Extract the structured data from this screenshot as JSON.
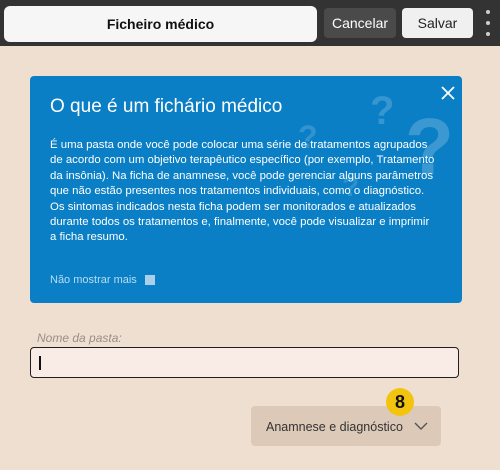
{
  "header": {
    "title": "Ficheiro médico",
    "cancel_label": "Cancelar",
    "save_label": "Salvar"
  },
  "info_card": {
    "title": "O que é um fichário médico",
    "body": "É uma pasta onde você pode colocar uma série de tratamentos agrupados de acordo com um objetivo terapêutico específico (por exemplo, Tratamento da insônia). Na ficha de anamnese, você pode gerenciar alguns parâmetros que não estão presentes nos tratamentos individuais, como o diagnóstico. Os sintomas indicados nesta ficha podem ser monitorados e atualizados durante todos os tratamentos e, finalmente, você pode visualizar e imprimir a ficha resumo.",
    "dont_show_label": "Não mostrar mais",
    "dont_show_checked": false
  },
  "folder_name": {
    "label": "Nome da pasta:",
    "value": ""
  },
  "dropdown": {
    "selected": "Anamnese e diagnóstico"
  },
  "badge": {
    "value": "8"
  },
  "colors": {
    "topbar": "#333333",
    "card": "#0a7fc6",
    "background": "#efdfd0",
    "badge": "#f2c40f"
  }
}
